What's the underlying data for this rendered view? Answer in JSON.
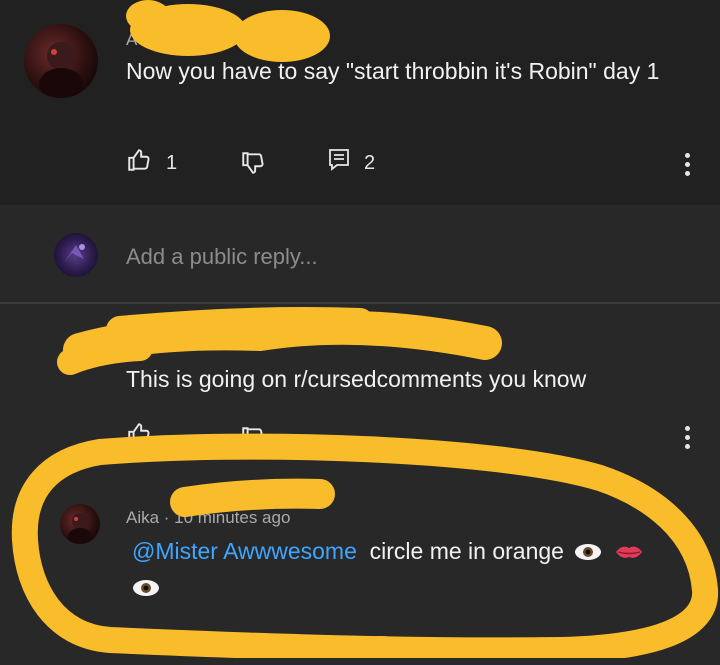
{
  "comments": [
    {
      "author": "A",
      "text": "Now you have to say \"start throbbin it's Robin\" day 1",
      "likes": "1",
      "replies": "2"
    },
    {
      "text": "This is going on r/cursedcomments you know"
    },
    {
      "author_meta": "Aika · 10 minutes ago",
      "mention": "@Mister Awwwesome",
      "text": "circle me in orange"
    }
  ],
  "reply_input": {
    "placeholder": "Add a public reply..."
  },
  "icons": [
    "like-icon",
    "dislike-icon",
    "reply-icon",
    "more-options-icon",
    "eye-emoji",
    "lips-emoji"
  ],
  "colors": {
    "background": "#212121",
    "text": "#f1f1f1",
    "mention": "#3ea6ff",
    "scribble": "#f9bd2b"
  }
}
